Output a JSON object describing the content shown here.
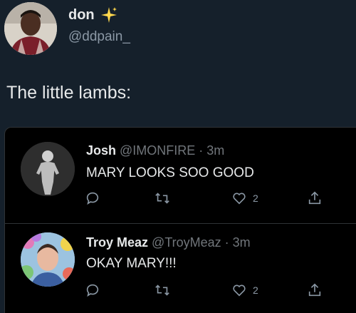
{
  "tweet": {
    "author_name": "don",
    "author_handle": "@ddpain_",
    "text": "The little lambs:"
  },
  "replies": [
    {
      "name": "Josh",
      "meta": "@IMONFIRE · 3m",
      "text": "MARY LOOKS SOO GOOD",
      "like_count": "2"
    },
    {
      "name": "Troy Meaz",
      "meta": "@TroyMeaz · 3m",
      "text": "OKAY MARY!!!",
      "like_count": "2"
    }
  ],
  "colors": {
    "background": "#15202b",
    "card": "#000000",
    "text": "#e7e9ea",
    "muted": "#8b98a5",
    "sparkle": "#ffd84d"
  },
  "icons": [
    "sparkle-icon",
    "reply-icon",
    "retweet-icon",
    "heart-icon",
    "share-icon"
  ]
}
